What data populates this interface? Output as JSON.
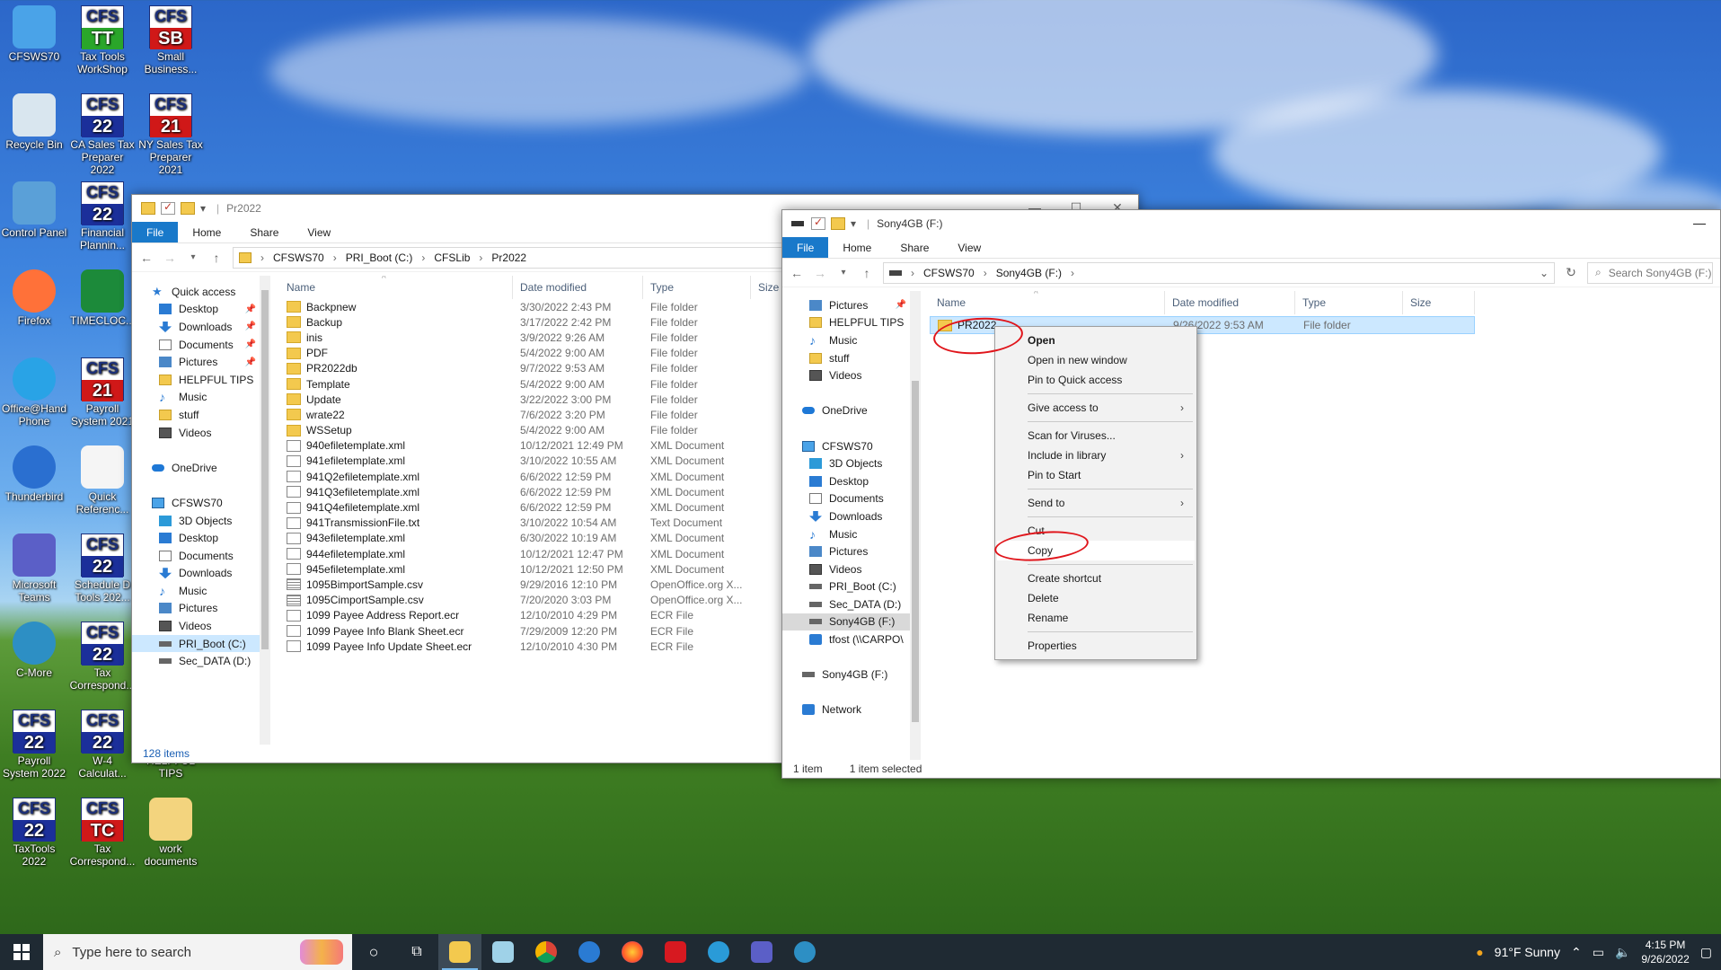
{
  "desktop_icons": [
    {
      "label": "CFSWS70",
      "type": "pc"
    },
    {
      "label": "Tax Tools WorkShop",
      "type": "cfs",
      "top": "CFS",
      "bottom": "TT",
      "color": "green"
    },
    {
      "label": "Small Business...",
      "type": "cfs",
      "top": "CFS",
      "bottom": "SB",
      "color": "red"
    },
    {
      "label": "Recycle Bin",
      "type": "bin"
    },
    {
      "label": "CA Sales Tax Preparer 2022",
      "type": "cfs",
      "top": "CFS",
      "bottom": "22",
      "color": "blue"
    },
    {
      "label": "NY Sales Tax Preparer 2021",
      "type": "cfs",
      "top": "CFS",
      "bottom": "21",
      "color": "red"
    },
    {
      "label": "Control Panel",
      "type": "cp"
    },
    {
      "label": "Financial Plannin...",
      "type": "cfs",
      "top": "CFS",
      "bottom": "22",
      "color": "blue"
    },
    {
      "label": "Firefox",
      "type": "ff"
    },
    {
      "label": "TIMECLOC...",
      "type": "tc"
    },
    {
      "label": "Office@Hand Phone",
      "type": "oh"
    },
    {
      "label": "Payroll System 2021",
      "type": "cfs",
      "top": "CFS",
      "bottom": "21",
      "color": "red"
    },
    {
      "label": "Thunderbird",
      "type": "tb"
    },
    {
      "label": "Quick Referenc...",
      "type": "book"
    },
    {
      "label": "Microsoft Teams",
      "type": "teams"
    },
    {
      "label": "Schedule D Tools 202...",
      "type": "cfs",
      "top": "CFS",
      "bottom": "22",
      "color": "blue"
    },
    {
      "label": "C-More",
      "type": "cmore"
    },
    {
      "label": "Tax Correspond...",
      "type": "cfs",
      "top": "CFS",
      "bottom": "22",
      "color": "blue"
    },
    {
      "label": "Payroll System 2022",
      "type": "cfs",
      "top": "CFS",
      "bottom": "22",
      "color": "blue"
    },
    {
      "label": "W-4 Calculat...",
      "type": "cfs",
      "top": "CFS",
      "bottom": "22",
      "color": "blue"
    },
    {
      "label": "HELPFUL TIPS",
      "type": "none"
    },
    {
      "label": "TaxTools 2022",
      "type": "cfs",
      "top": "CFS",
      "bottom": "22",
      "color": "blue"
    },
    {
      "label": "Tax Correspond...",
      "type": "cfs",
      "top": "CFS",
      "bottom": "TC",
      "color": "red"
    },
    {
      "label": "work documents",
      "type": "folder"
    }
  ],
  "win1": {
    "title": "Pr2022",
    "ribbon": [
      "File",
      "Home",
      "Share",
      "View"
    ],
    "path": [
      "CFSWS70",
      "PRI_Boot (C:)",
      "CFSLib",
      "Pr2022"
    ],
    "nav": [
      {
        "label": "Quick access",
        "icon": "star"
      },
      {
        "label": "Desktop",
        "icon": "blue",
        "pin": true
      },
      {
        "label": "Downloads",
        "icon": "dl",
        "pin": true
      },
      {
        "label": "Documents",
        "icon": "doc",
        "pin": true
      },
      {
        "label": "Pictures",
        "icon": "pic",
        "pin": true
      },
      {
        "label": "HELPFUL TIPS",
        "icon": "folder"
      },
      {
        "label": "Music",
        "icon": "music"
      },
      {
        "label": "stuff",
        "icon": "folder"
      },
      {
        "label": "Videos",
        "icon": "vid"
      },
      {
        "label": "",
        "icon": ""
      },
      {
        "label": "OneDrive",
        "icon": "cloud"
      },
      {
        "label": "",
        "icon": ""
      },
      {
        "label": "CFSWS70",
        "icon": "pc"
      },
      {
        "label": "3D Objects",
        "icon": "cube"
      },
      {
        "label": "Desktop",
        "icon": "blue"
      },
      {
        "label": "Documents",
        "icon": "doc"
      },
      {
        "label": "Downloads",
        "icon": "dl"
      },
      {
        "label": "Music",
        "icon": "music"
      },
      {
        "label": "Pictures",
        "icon": "pic"
      },
      {
        "label": "Videos",
        "icon": "vid"
      },
      {
        "label": "PRI_Boot (C:)",
        "icon": "drive",
        "sel": true
      },
      {
        "label": "Sec_DATA (D:)",
        "icon": "drive"
      }
    ],
    "columns": [
      "Name",
      "Date modified",
      "Type",
      "Size"
    ],
    "files": [
      {
        "name": "Backpnew",
        "date": "3/30/2022 2:43 PM",
        "type": "File folder",
        "icon": "folder"
      },
      {
        "name": "Backup",
        "date": "3/17/2022 2:42 PM",
        "type": "File folder",
        "icon": "folder"
      },
      {
        "name": "inis",
        "date": "3/9/2022 9:26 AM",
        "type": "File folder",
        "icon": "folder"
      },
      {
        "name": "PDF",
        "date": "5/4/2022 9:00 AM",
        "type": "File folder",
        "icon": "folder"
      },
      {
        "name": "PR2022db",
        "date": "9/7/2022 9:53 AM",
        "type": "File folder",
        "icon": "folder"
      },
      {
        "name": "Template",
        "date": "5/4/2022 9:00 AM",
        "type": "File folder",
        "icon": "folder"
      },
      {
        "name": "Update",
        "date": "3/22/2022 3:00 PM",
        "type": "File folder",
        "icon": "folder"
      },
      {
        "name": "wrate22",
        "date": "7/6/2022 3:20 PM",
        "type": "File folder",
        "icon": "folder"
      },
      {
        "name": "WSSetup",
        "date": "5/4/2022 9:00 AM",
        "type": "File folder",
        "icon": "folder"
      },
      {
        "name": "940efiletemplate.xml",
        "date": "10/12/2021 12:49 PM",
        "type": "XML Document",
        "icon": "xml"
      },
      {
        "name": "941efiletemplate.xml",
        "date": "3/10/2022 10:55 AM",
        "type": "XML Document",
        "icon": "xml"
      },
      {
        "name": "941Q2efiletemplate.xml",
        "date": "6/6/2022 12:59 PM",
        "type": "XML Document",
        "icon": "xml"
      },
      {
        "name": "941Q3efiletemplate.xml",
        "date": "6/6/2022 12:59 PM",
        "type": "XML Document",
        "icon": "xml"
      },
      {
        "name": "941Q4efiletemplate.xml",
        "date": "6/6/2022 12:59 PM",
        "type": "XML Document",
        "icon": "xml"
      },
      {
        "name": "941TransmissionFile.txt",
        "date": "3/10/2022 10:54 AM",
        "type": "Text Document",
        "icon": "txt"
      },
      {
        "name": "943efiletemplate.xml",
        "date": "6/30/2022 10:19 AM",
        "type": "XML Document",
        "icon": "xml"
      },
      {
        "name": "944efiletemplate.xml",
        "date": "10/12/2021 12:47 PM",
        "type": "XML Document",
        "icon": "xml"
      },
      {
        "name": "945efiletemplate.xml",
        "date": "10/12/2021 12:50 PM",
        "type": "XML Document",
        "icon": "xml"
      },
      {
        "name": "1095BimportSample.csv",
        "date": "9/29/2016 12:10 PM",
        "type": "OpenOffice.org X...",
        "icon": "csv"
      },
      {
        "name": "1095CimportSample.csv",
        "date": "7/20/2020 3:03 PM",
        "type": "OpenOffice.org X...",
        "icon": "csv"
      },
      {
        "name": "1099 Payee Address Report.ecr",
        "date": "12/10/2010 4:29 PM",
        "type": "ECR File",
        "icon": "ecr"
      },
      {
        "name": "1099 Payee Info Blank Sheet.ecr",
        "date": "7/29/2009 12:20 PM",
        "type": "ECR File",
        "icon": "ecr"
      },
      {
        "name": "1099 Payee Info Update Sheet.ecr",
        "date": "12/10/2010 4:30 PM",
        "type": "ECR File",
        "icon": "ecr"
      }
    ],
    "status": "128 items"
  },
  "win2": {
    "title": "Sony4GB (F:)",
    "ribbon": [
      "File",
      "Home",
      "Share",
      "View"
    ],
    "path": [
      "CFSWS70",
      "Sony4GB (F:)"
    ],
    "search_placeholder": "Search Sony4GB (F:)",
    "nav": [
      {
        "label": "Pictures",
        "icon": "pic",
        "pin": true
      },
      {
        "label": "HELPFUL TIPS",
        "icon": "folder"
      },
      {
        "label": "Music",
        "icon": "music"
      },
      {
        "label": "stuff",
        "icon": "folder"
      },
      {
        "label": "Videos",
        "icon": "vid"
      },
      {
        "label": "",
        "icon": ""
      },
      {
        "label": "OneDrive",
        "icon": "cloud"
      },
      {
        "label": "",
        "icon": ""
      },
      {
        "label": "CFSWS70",
        "icon": "pc"
      },
      {
        "label": "3D Objects",
        "icon": "cube"
      },
      {
        "label": "Desktop",
        "icon": "blue"
      },
      {
        "label": "Documents",
        "icon": "doc"
      },
      {
        "label": "Downloads",
        "icon": "dl"
      },
      {
        "label": "Music",
        "icon": "music"
      },
      {
        "label": "Pictures",
        "icon": "pic"
      },
      {
        "label": "Videos",
        "icon": "vid"
      },
      {
        "label": "PRI_Boot (C:)",
        "icon": "drive"
      },
      {
        "label": "Sec_DATA (D:)",
        "icon": "drive"
      },
      {
        "label": "Sony4GB (F:)",
        "icon": "drive",
        "hov": true
      },
      {
        "label": "tfost (\\\\CARPO\\",
        "icon": "net"
      },
      {
        "label": "",
        "icon": ""
      },
      {
        "label": "Sony4GB (F:)",
        "icon": "drive"
      },
      {
        "label": "",
        "icon": ""
      },
      {
        "label": "Network",
        "icon": "net"
      }
    ],
    "columns": [
      "Name",
      "Date modified",
      "Type",
      "Size"
    ],
    "files": [
      {
        "name": "PR2022",
        "date": "9/26/2022 9:53 AM",
        "type": "File folder",
        "icon": "folder"
      }
    ],
    "status_items": "1 item",
    "status_selected": "1 item selected"
  },
  "context_menu": [
    {
      "label": "Open",
      "bold": true
    },
    {
      "label": "Open in new window"
    },
    {
      "label": "Pin to Quick access"
    },
    {
      "sep": true
    },
    {
      "label": "Give access to",
      "arrow": true
    },
    {
      "sep": true
    },
    {
      "label": "Scan for Viruses..."
    },
    {
      "label": "Include in library",
      "arrow": true
    },
    {
      "label": "Pin to Start"
    },
    {
      "sep": true
    },
    {
      "label": "Send to",
      "arrow": true
    },
    {
      "sep": true
    },
    {
      "label": "Cut"
    },
    {
      "label": "Copy",
      "highlight": true
    },
    {
      "sep": true
    },
    {
      "label": "Create shortcut"
    },
    {
      "label": "Delete"
    },
    {
      "label": "Rename"
    },
    {
      "sep": true
    },
    {
      "label": "Properties"
    }
  ],
  "taskbar": {
    "search_placeholder": "Type here to search",
    "weather": "91°F  Sunny",
    "time": "4:15 PM",
    "date": "9/26/2022",
    "apps": [
      "task-view-icon",
      "file-explorer-icon",
      "notepad-icon",
      "chrome-icon",
      "thunderbird-icon",
      "firefox-icon",
      "acrobat-icon",
      "health-icon",
      "teams-icon",
      "phone-icon"
    ]
  }
}
